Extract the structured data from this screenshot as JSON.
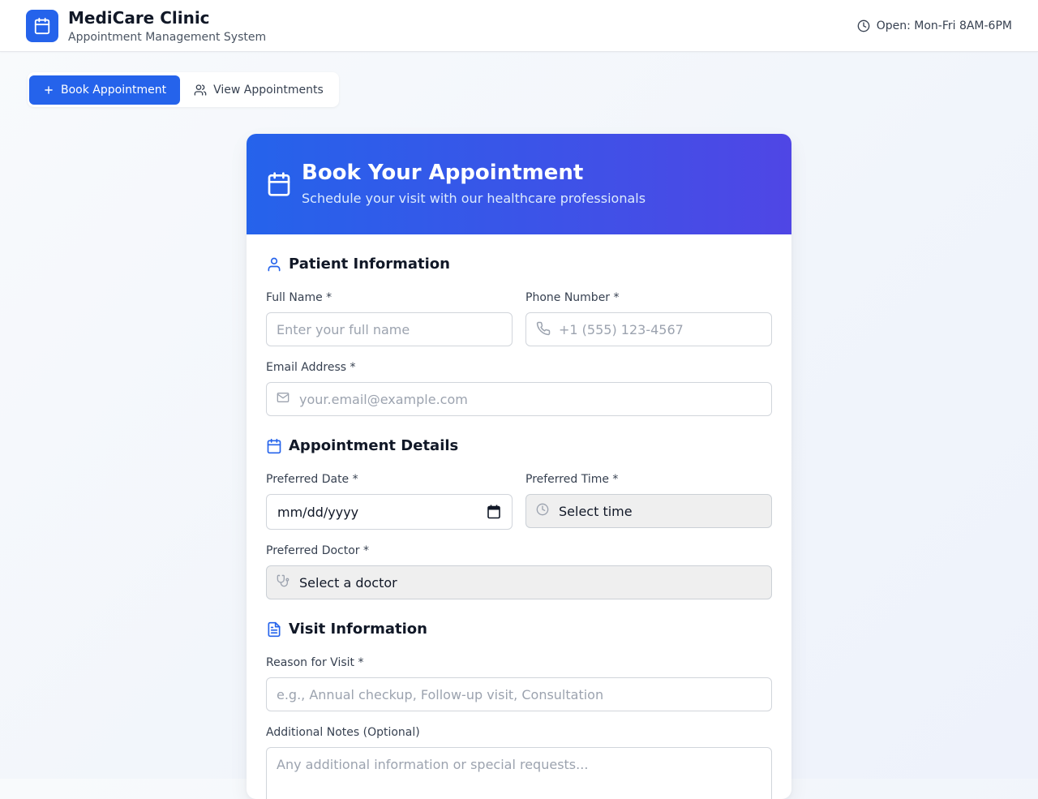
{
  "header": {
    "title": "MediCare Clinic",
    "subtitle": "Appointment Management System",
    "hours": "Open: Mon-Fri 8AM-6PM"
  },
  "tabs": [
    {
      "label": "Book Appointment",
      "icon": "plus-icon",
      "active": true
    },
    {
      "label": "View Appointments",
      "icon": "users-icon",
      "active": false
    }
  ],
  "card": {
    "title": "Book Your Appointment",
    "subtitle": "Schedule your visit with our healthcare professionals"
  },
  "patient": {
    "section_title": "Patient Information",
    "full_name": {
      "label": "Full Name *",
      "placeholder": "Enter your full name",
      "value": ""
    },
    "phone": {
      "label": "Phone Number *",
      "placeholder": "+1 (555) 123-4567",
      "value": ""
    },
    "email": {
      "label": "Email Address *",
      "placeholder": "your.email@example.com",
      "value": ""
    }
  },
  "appointment": {
    "section_title": "Appointment Details",
    "date": {
      "label": "Preferred Date *",
      "display": "mm/dd/yyyy"
    },
    "time": {
      "label": "Preferred Time *",
      "selected": "Select time"
    },
    "doctor": {
      "label": "Preferred Doctor *",
      "selected": "Select a doctor"
    }
  },
  "visit": {
    "section_title": "Visit Information",
    "reason": {
      "label": "Reason for Visit *",
      "placeholder": "e.g., Annual checkup, Follow-up visit, Consultation",
      "value": ""
    },
    "notes": {
      "label": "Additional Notes (Optional)",
      "placeholder": "Any additional information or special requests...",
      "value": ""
    }
  },
  "colors": {
    "primary": "#2563eb",
    "gradient_end": "#4f46e5",
    "text": "#111827",
    "muted": "#4b5563",
    "placeholder": "#9ca3af"
  }
}
